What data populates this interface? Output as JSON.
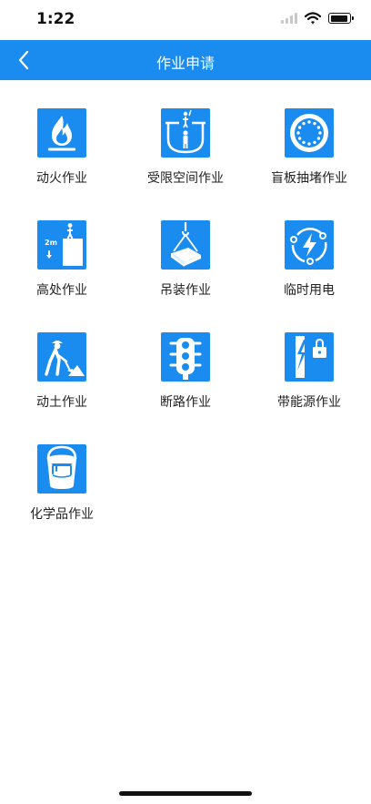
{
  "status_bar": {
    "time": "1:22"
  },
  "nav": {
    "title": "作业申请"
  },
  "colors": {
    "accent": "#1a8cf0",
    "icon_fg": "#ffffff"
  },
  "tiles": [
    {
      "label": "动火作业",
      "icon": "fire-icon"
    },
    {
      "label": "受限空间作业",
      "icon": "confined-space-icon"
    },
    {
      "label": "盲板抽堵作业",
      "icon": "blind-plate-icon"
    },
    {
      "label": "高处作业",
      "icon": "height-work-icon"
    },
    {
      "label": "吊装作业",
      "icon": "lifting-icon"
    },
    {
      "label": "临时用电",
      "icon": "temporary-electricity-icon"
    },
    {
      "label": "动土作业",
      "icon": "excavation-icon"
    },
    {
      "label": "断路作业",
      "icon": "traffic-light-icon"
    },
    {
      "label": "带能源作业",
      "icon": "energy-lock-icon"
    },
    {
      "label": "化学品作业",
      "icon": "chemical-bucket-icon"
    }
  ]
}
